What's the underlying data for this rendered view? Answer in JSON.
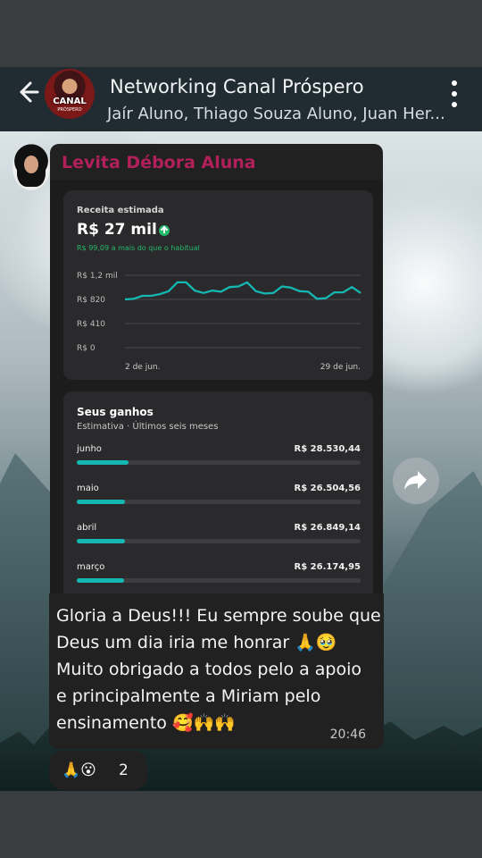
{
  "header": {
    "group_name": "Networking Canal Próspero",
    "members_preview": "Jaír Aluno, Thiago Souza Aluno, Juan Her...",
    "avatar_text": "CANAL",
    "avatar_subtext": "PRÓSPERO"
  },
  "message": {
    "sender": "Levita Débora Aluna",
    "body": "Gloria a Deus!!! Eu sempre soube que\nDeus um dia iria me honrar 🙏🥹\nMuito obrigado a todos pelo a apoio\ne principalmente a Miriam pelo\nensinamento 🥰🙌🙌",
    "time": "20:46",
    "reactions": "🙏😮",
    "reaction_count": "2"
  },
  "screenshot_image": {
    "revenue_label": "Receita estimada",
    "revenue_value": "R$ 27 mil",
    "trend_text": "R$ 99,09 a mais do que o habitual",
    "chart_start": "2 de jun.",
    "chart_end": "29 de jun.",
    "gains_title": "Seus ganhos",
    "gains_subtitle": "Estimativa · Últimos seis meses",
    "months": [
      {
        "month": "junho",
        "amount": "R$ 28.530,44"
      },
      {
        "month": "maio",
        "amount": "R$ 26.504,56"
      },
      {
        "month": "abril",
        "amount": "R$ 26.849,14"
      },
      {
        "month": "março",
        "amount": "R$ 26.174,95"
      }
    ]
  },
  "chart_data": {
    "type": "line",
    "title": "Receita estimada",
    "x": [
      "2 de jun.",
      "3",
      "4",
      "5",
      "6",
      "7",
      "8",
      "9",
      "10",
      "11",
      "12",
      "13",
      "14",
      "15",
      "16",
      "17",
      "18",
      "19",
      "20",
      "21",
      "22",
      "23",
      "24",
      "25",
      "26",
      "27",
      "28",
      "29 de jun."
    ],
    "series": [
      {
        "values": [
          820,
          830,
          880,
          880,
          910,
          960,
          1110,
          1110,
          970,
          930,
          970,
          950,
          1030,
          1040,
          1110,
          960,
          920,
          930,
          1040,
          1020,
          960,
          950,
          830,
          840,
          940,
          940,
          1030,
          930
        ]
      }
    ],
    "yticks": [
      "R$ 1,2 mil",
      "R$ 820",
      "R$ 410",
      "R$ 0"
    ],
    "ylim": [
      0,
      1230
    ],
    "grid": true
  },
  "colors": {
    "header_bg": "#212b32",
    "bubble_bg": "#212121",
    "sender_name": "#b1205a",
    "accent_teal": "#15b7b3",
    "positive_green": "#24b86a"
  }
}
